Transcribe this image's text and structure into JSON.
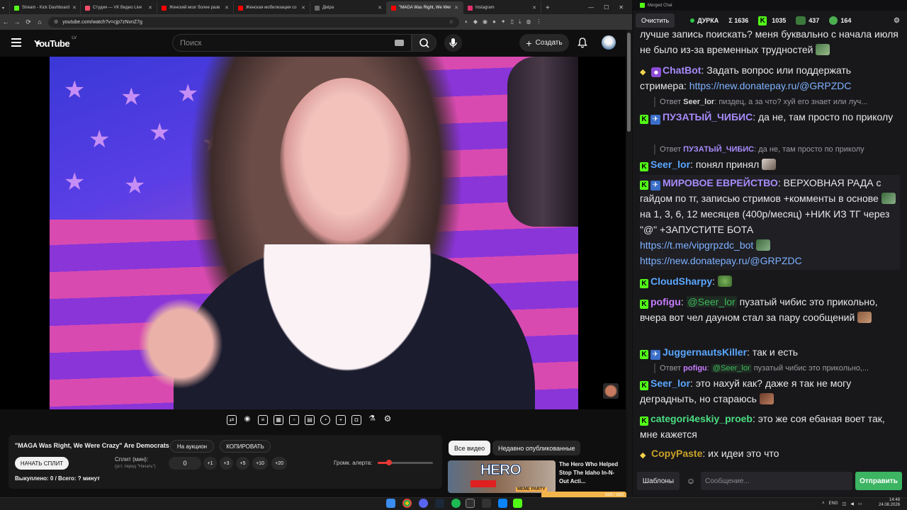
{
  "browser": {
    "tabs": [
      {
        "label": "Stream - Kick Dashboard",
        "color": "#53fc18"
      },
      {
        "label": "Студия — VK Видео Live",
        "color": "#ff4d6a"
      },
      {
        "label": "Женский мозг более разв",
        "color": "#ff0000"
      },
      {
        "label": "Женская мобилизация со",
        "color": "#ff0000"
      },
      {
        "label": "Дiкiрa",
        "color": "#6a6a6a"
      },
      {
        "label": "\"MAGA Was Right, We Wer",
        "color": "#ff0000"
      },
      {
        "label": "Instagram",
        "color": "#e1306c"
      }
    ],
    "url": "youtube.com/watch?v=cjp7zNvnZ7g"
  },
  "youtube": {
    "logo_text": "YouTube",
    "region": "LV",
    "search_placeholder": "Поиск",
    "create_label": "Создать"
  },
  "toolbar_icons": [
    "loop-icon",
    "cast-icon",
    "subtitles-icon",
    "clapper-icon",
    "pip-icon",
    "miniplayer-icon",
    "speed-icon",
    "add-icon",
    "camera-icon",
    "flask-icon",
    "settings-icon"
  ],
  "auction": {
    "video_title": "\"MAGA Was Right, We Were Crazy\" Are Democrats Ok?",
    "to_auction_label": "На аукцион",
    "copy_label": "КОПИРОВАТЬ",
    "start_split_label": "НАЧАТЬ СПЛИТ",
    "split_label": "Сплит (мин):",
    "split_hint": "(уст. перед \"Начать\")",
    "split_value": "0",
    "increments": [
      "+1",
      "+3",
      "+5",
      "+10",
      "+20"
    ],
    "alert_volume_label": "Громк. алерта:",
    "alert_volume": 0.2,
    "bought_label": "Выкуплено: 0 / Всего: ? минут"
  },
  "recommendations": {
    "chips": [
      "Все видео",
      "Недавно опубликованные"
    ],
    "video_title": "The Hero Who Helped Stop The Idaho In-N-Out Acti...",
    "thumb_text": "HERO",
    "thumb_tag": "MEME PARTY",
    "progress_text": "1025 / 1500"
  },
  "chat": {
    "window_title": "Merged Chat",
    "clear_label": "Очистить",
    "channel": "ДУРКА",
    "stats": [
      {
        "icon": "sigma",
        "value": "Σ 1636"
      },
      {
        "icon": "kick",
        "value": "1035"
      },
      {
        "icon": "vk",
        "value": "437"
      },
      {
        "icon": "twitch",
        "value": "164"
      }
    ],
    "messages": [
      {
        "text": "лучше запись поискать? меня буквально с начала июля не было из-за временных трудностей"
      },
      {
        "nick": "ChatBot",
        "nick_color": "#a78bfa",
        "text": "Задать вопрос или поддержать стримера: ",
        "link": "https://new.donatepay.ru/@GRPZDC"
      },
      {
        "reply_to": "Seer_lor",
        "reply_text": "пиздец, а за что? хуй его знает или луч..."
      },
      {
        "nick": "ПУЗАТЫЙ_ЧИБИС",
        "nick_color": "#a78bfa",
        "text": "да не, там просто по приколу"
      },
      {
        "reply_to": "ПУЗАТЫЙ_ЧИБИС",
        "reply_text": "да не, там просто по приколу"
      },
      {
        "nick": "Seer_lor",
        "nick_color": "#5ba7ff",
        "text": "понял принял"
      },
      {
        "nick": "МИРОВОЕ ЕВРЕЙСТВО",
        "nick_color": "#a78bfa",
        "text": "ВЕРХОВНАЯ РАДА с гайдом по тг, записью стримов +комменты в основе",
        "text2": "на 1, 3, 6, 12 месяцев (400р/месяц) +НИК ИЗ ТГ через \"@\" +ЗАПУСТИТЕ БОТА",
        "link": "https://t.me/vipgrpzdc_bot",
        "link2": "https://new.donatepay.ru/@GRPZDC"
      },
      {
        "nick": "CloudSharpy",
        "nick_color": "#5ba7ff",
        "text": ""
      },
      {
        "nick": "pofigu",
        "nick_color": "#c77dff",
        "mention": "@Seer_lor",
        "text": "пузатый чибис это прикольно, вчера вот чел дауном стал за пару сообщений"
      },
      {
        "nick": "JuggernautsKiller",
        "nick_color": "#5ba7ff",
        "text": "так и есть"
      },
      {
        "reply_to": "pofigu",
        "reply_mention": "@Seer_lor",
        "reply_text": "пузатый чибис это прикольно,..."
      },
      {
        "nick": "Seer_lor",
        "nick_color": "#5ba7ff",
        "text": "это нахуй как? даже я так не могу деградныть, но стараюсь"
      },
      {
        "nick": "categori4eskiy_proeb",
        "nick_color": "#4ade80",
        "text": "это же соя ебаная воет так, мне кажется"
      },
      {
        "nick": "CopyPaste",
        "nick_color": "#c9a227",
        "text": "их идеи это что"
      }
    ],
    "reply_prefix": "Ответ",
    "templates_label": "Шаблоны",
    "input_placeholder": "Сообщение...",
    "send_label": "Отправить"
  },
  "taskbar": {
    "lang": "ENG",
    "time": "14:48",
    "date": "24.08.2026"
  }
}
